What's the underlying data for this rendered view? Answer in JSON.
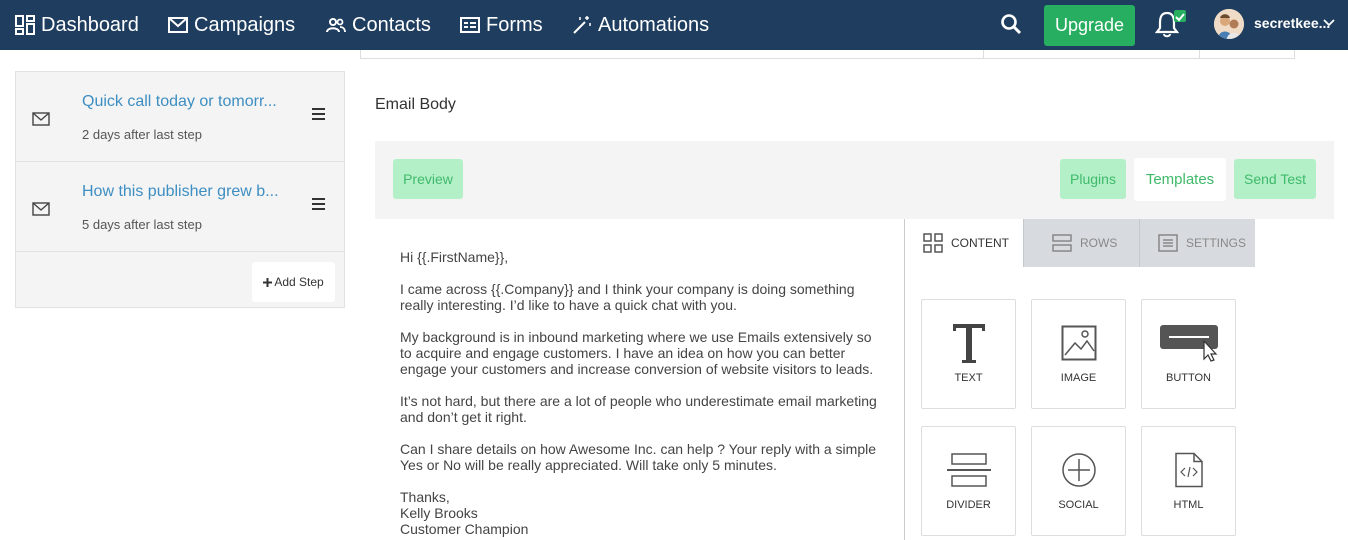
{
  "nav": {
    "items": [
      {
        "label": "Dashboard",
        "icon": "dashboard-icon"
      },
      {
        "label": "Campaigns",
        "icon": "envelope-icon"
      },
      {
        "label": "Contacts",
        "icon": "people-icon"
      },
      {
        "label": "Forms",
        "icon": "form-icon"
      },
      {
        "label": "Automations",
        "icon": "magic-wand-icon"
      }
    ],
    "upgrade_label": "Upgrade",
    "username": "secretkee..."
  },
  "steps": [
    {
      "title": "Quick call today or tomorr...",
      "subtitle": "2 days after last step"
    },
    {
      "title": "How this publisher grew b...",
      "subtitle": "5 days after last step"
    }
  ],
  "add_step_label": "Add Step",
  "email_body_label": "Email Body",
  "toolbar": {
    "preview": "Preview",
    "plugins": "Plugins",
    "templates": "Templates",
    "send_test": "Send Test"
  },
  "email": {
    "p1": "Hi {{.FirstName}},",
    "p2": "I came across {{.Company}} and I think your company is doing something really interesting. I’d like to have a quick chat with you.",
    "p3": "My background is in inbound marketing where we use Emails extensively so to acquire and engage customers. I have an idea on how you can better engage your customers and increase conversion of website visitors to leads.",
    "p4": "It’s not hard, but there are a lot of people who underestimate email marketing and don’t get it right.",
    "p5": "Can I share details on how Awesome Inc. can help ? Your reply with a simple Yes or No will be really appreciated. Will take only 5 minutes.",
    "sign1": "Thanks,",
    "sign2": "Kelly Brooks",
    "sign3": "Customer Champion"
  },
  "editor": {
    "tabs": {
      "content": "CONTENT",
      "rows": "ROWS",
      "settings": "SETTINGS"
    },
    "tiles": {
      "text": "TEXT",
      "image": "IMAGE",
      "button": "BUTTON",
      "divider": "DIVIDER",
      "social": "SOCIAL",
      "html": "HTML"
    }
  },
  "colors": {
    "nav_bg": "#1f3e5f",
    "upgrade": "#27ae60",
    "link": "#3d8ec2",
    "toolbar_button": "#b3f0c8"
  }
}
